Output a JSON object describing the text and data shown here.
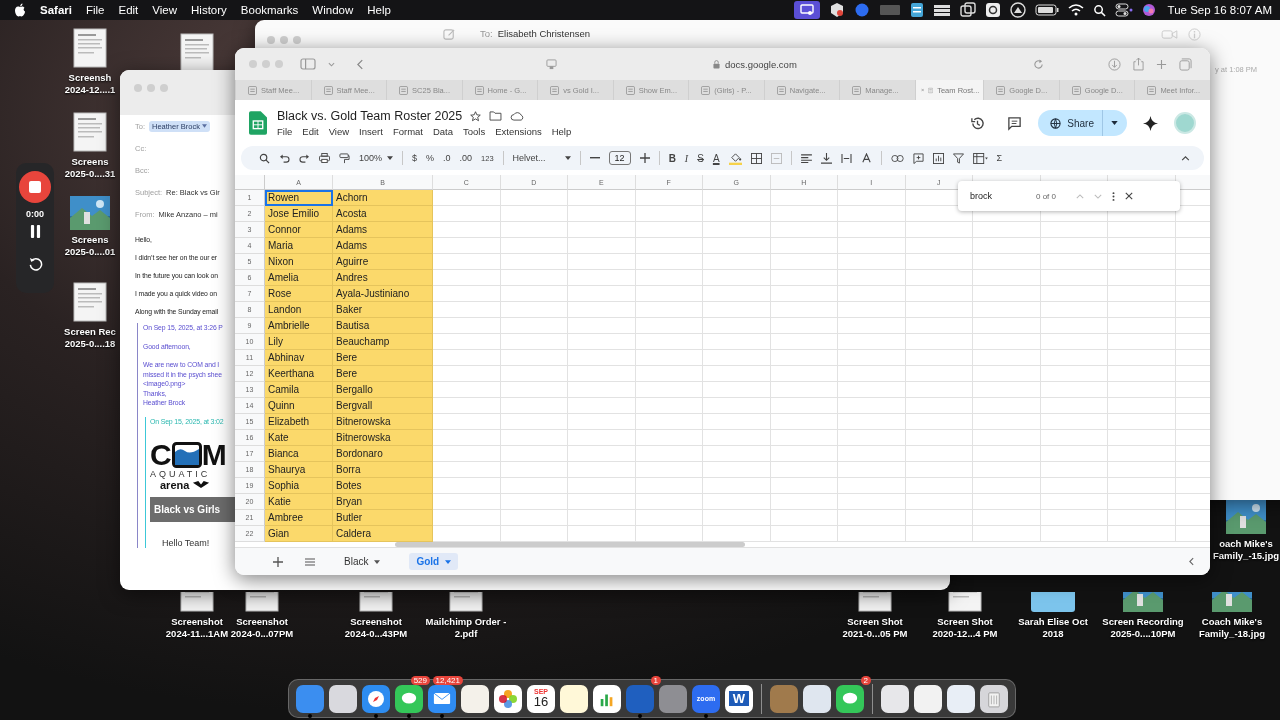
{
  "menu_bar": {
    "app": "Safari",
    "menus": [
      "File",
      "Edit",
      "View",
      "History",
      "Bookmarks",
      "Window",
      "Help"
    ],
    "clock": "Tue Sep 16  8:07 AM"
  },
  "recorder": {
    "time": "0:00"
  },
  "desktop_files": [
    {
      "kind": "document",
      "line1": "Screensh",
      "line2": "2024-12....1"
    },
    {
      "kind": "document"
    },
    {
      "kind": "document",
      "line1": "Screens",
      "line2": "2025-0....31"
    },
    {
      "line1": "Screens",
      "line2": "2025-0....01"
    },
    {
      "kind": "document",
      "line1": "Screen Rec",
      "line2": "2025-0....18"
    },
    {
      "line1": "oach Mike's",
      "line2": "Family_-15.jpg"
    },
    {
      "kind": "document",
      "line1": "Screenshot",
      "line2": "2024-11...1AM"
    },
    {
      "kind": "document",
      "line1": "Screenshot",
      "line2": "2024-0...07PM"
    },
    {
      "kind": "document",
      "line1": "Screenshot",
      "line2": "2024-0...43PM"
    },
    {
      "kind": "document",
      "line1": "Mailchimp Order -",
      "line2": "2.pdf"
    },
    {
      "kind": "document",
      "line1": "Screen Shot",
      "line2": "2021-0...05 PM"
    },
    {
      "kind": "document",
      "line1": "Screen Shot",
      "line2": "2020-12...4 PM"
    },
    {
      "kind": "folder",
      "line1": "Sarah Elise Oct",
      "line2": "2018"
    },
    {
      "line1": "Screen Recording",
      "line2": "2025-0....10PM"
    },
    {
      "line1": "Coach Mike's",
      "line2": "Family_-18.jpg"
    }
  ],
  "back_mail": {
    "to_label": "To:",
    "to": "Elisabeth Christensen",
    "side_text": "y at 1:08 PM"
  },
  "mail": {
    "fields": [
      {
        "label": "To:",
        "value": "Heather Brock",
        "kind": "token"
      },
      {
        "label": "Cc:"
      },
      {
        "label": "Bcc:"
      },
      {
        "label": "Subject:",
        "value": "Re: Black vs Gir",
        "kind": "plain"
      },
      {
        "label": "From:",
        "value": "Mike Anzano – mi",
        "kind": "plain"
      }
    ],
    "body": [
      "Hello,",
      "I didn’t see her on the our er",
      "In the future you can look on",
      "I made you a quick video on",
      "Along with the Sunday email"
    ],
    "quote": {
      "paragraphs": [
        [
          "On Sep 15, 2025, at 3:26 P"
        ],
        [
          "Good afternoon,"
        ],
        [
          "We are new to COM and I",
          "missed it in the psych shee",
          "<image0.png>",
          "Thanks,",
          "Heather Brock"
        ]
      ],
      "nested": {
        "header": "On Sep 15, 2025, at 3:02",
        "logo": {
          "left": "C",
          "right": "M",
          "sub": "AQUATIC",
          "brand": "arena"
        },
        "banner": "Black vs Girls",
        "greeting": "Hello Team!"
      }
    }
  },
  "safari": {
    "url": "docs.google.com",
    "tabs": [
      {
        "label": "Staff Mee...",
        "selected": false
      },
      {
        "label": "Staff Mee...",
        "selected": false
      },
      {
        "label": "SC25 Bla...",
        "selected": false
      },
      {
        "label": "Home - G...",
        "selected": false
      },
      {
        "label": "vs Gold I...",
        "selected": false
      },
      {
        "label": "Show Em...",
        "selected": false
      },
      {
        "label": "(Girls) - P...",
        "selected": false
      },
      {
        "label": "Navigate...",
        "selected": false
      },
      {
        "label": "Manage...",
        "selected": false
      },
      {
        "label": "Team Rost...",
        "selected": true
      },
      {
        "label": "Google D...",
        "selected": false
      },
      {
        "label": "Google D...",
        "selected": false
      },
      {
        "label": "Meet Infor...",
        "selected": false
      }
    ]
  },
  "sheet": {
    "title": "Black vs. Gold Team Roster 2025",
    "menus": [
      "File",
      "Edit",
      "View",
      "Insert",
      "Format",
      "Data",
      "Tools",
      "Extensions",
      "Help"
    ],
    "share": "Share",
    "toolbar": {
      "zoom": "100%",
      "currency": "$",
      "percent": "%",
      "dec_less": ".0",
      "dec_more": ".00",
      "number_format": "123",
      "font": "Helvet...",
      "size": "12",
      "functions": "Σ"
    },
    "format_buttons": [
      {
        "label": "B",
        "kind": "bold"
      },
      {
        "label": "I",
        "kind": "italic"
      },
      {
        "label": "S",
        "kind": "strike"
      },
      {
        "label": "A",
        "kind": "color"
      }
    ],
    "columns": [
      "A",
      "B",
      "C",
      "D",
      "E",
      "F",
      "G",
      "H",
      "I",
      "J"
    ],
    "rows": [
      {
        "num": "1",
        "first": "Rowen",
        "last": "Achorn",
        "selected": true
      },
      {
        "num": "2",
        "first": "Jose Emilio",
        "last": "Acosta",
        "selected": false
      },
      {
        "num": "3",
        "first": "Connor",
        "last": "Adams",
        "selected": false
      },
      {
        "num": "4",
        "first": "Maria",
        "last": "Adams",
        "selected": false
      },
      {
        "num": "5",
        "first": "Nixon",
        "last": "Aguirre",
        "selected": false
      },
      {
        "num": "6",
        "first": "Amelia",
        "last": "Andres",
        "selected": false
      },
      {
        "num": "7",
        "first": "Rose",
        "last": "Ayala-Justiniano",
        "selected": false
      },
      {
        "num": "8",
        "first": "Landon",
        "last": "Baker",
        "selected": false
      },
      {
        "num": "9",
        "first": "Ambrielle",
        "last": "Bautisa",
        "selected": false
      },
      {
        "num": "10",
        "first": "Lily",
        "last": "Beauchamp",
        "selected": false
      },
      {
        "num": "11",
        "first": "Abhinav",
        "last": "Bere",
        "selected": false
      },
      {
        "num": "12",
        "first": "Keerthana",
        "last": "Bere",
        "selected": false
      },
      {
        "num": "13",
        "first": "Camila",
        "last": "Bergallo",
        "selected": false
      },
      {
        "num": "14",
        "first": "Quinn",
        "last": "Bergvall",
        "selected": false
      },
      {
        "num": "15",
        "first": "Elizabeth",
        "last": "Bitnerowska",
        "selected": false
      },
      {
        "num": "16",
        "first": "Kate",
        "last": "Bitnerowska",
        "selected": false
      },
      {
        "num": "17",
        "first": "Bianca",
        "last": "Bordonaro",
        "selected": false
      },
      {
        "num": "18",
        "first": "Shaurya",
        "last": "Borra",
        "selected": false
      },
      {
        "num": "19",
        "first": "Sophia",
        "last": "Botes",
        "selected": false
      },
      {
        "num": "20",
        "first": "Katie",
        "last": "Bryan",
        "selected": false
      },
      {
        "num": "21",
        "first": "Ambree",
        "last": "Butler",
        "selected": false
      },
      {
        "num": "22",
        "first": "Gian",
        "last": "Caldera",
        "selected": false
      }
    ],
    "find": {
      "query": "brock",
      "count": "0 of 0"
    },
    "sheet_tabs": [
      {
        "label": "Black",
        "selected": false
      },
      {
        "label": "Gold",
        "selected": true
      }
    ]
  },
  "dock": [
    {
      "kind": "finder",
      "running": true
    },
    {
      "kind": "launchpad",
      "running": false
    },
    {
      "kind": "safari",
      "running": true
    },
    {
      "kind": "messages",
      "badge": "529",
      "running": true
    },
    {
      "kind": "mail",
      "badge": "12,421",
      "running": true
    },
    {
      "kind": "pencil",
      "running": false
    },
    {
      "kind": "photos",
      "running": false
    },
    {
      "kind": "calendar",
      "month": "SEP",
      "day": "16",
      "running": false
    },
    {
      "kind": "notes",
      "running": false
    },
    {
      "kind": "numbers",
      "running": false
    },
    {
      "kind": "tasks",
      "badge": "1",
      "running": true
    },
    {
      "kind": "settings",
      "running": false
    },
    {
      "kind": "zoom",
      "label": "zoom",
      "running": true
    },
    {
      "kind": "word",
      "label": "W",
      "running": false
    },
    {
      "kind": "divider"
    },
    {
      "kind": "contacts",
      "running": false
    },
    {
      "kind": "preview",
      "running": false
    },
    {
      "kind": "facetime",
      "badge": "2",
      "running": false
    },
    {
      "kind": "divider"
    },
    {
      "kind": "printer",
      "running": false
    },
    {
      "kind": "file",
      "running": false
    },
    {
      "kind": "window",
      "running": false
    },
    {
      "kind": "trash",
      "running": false
    }
  ]
}
